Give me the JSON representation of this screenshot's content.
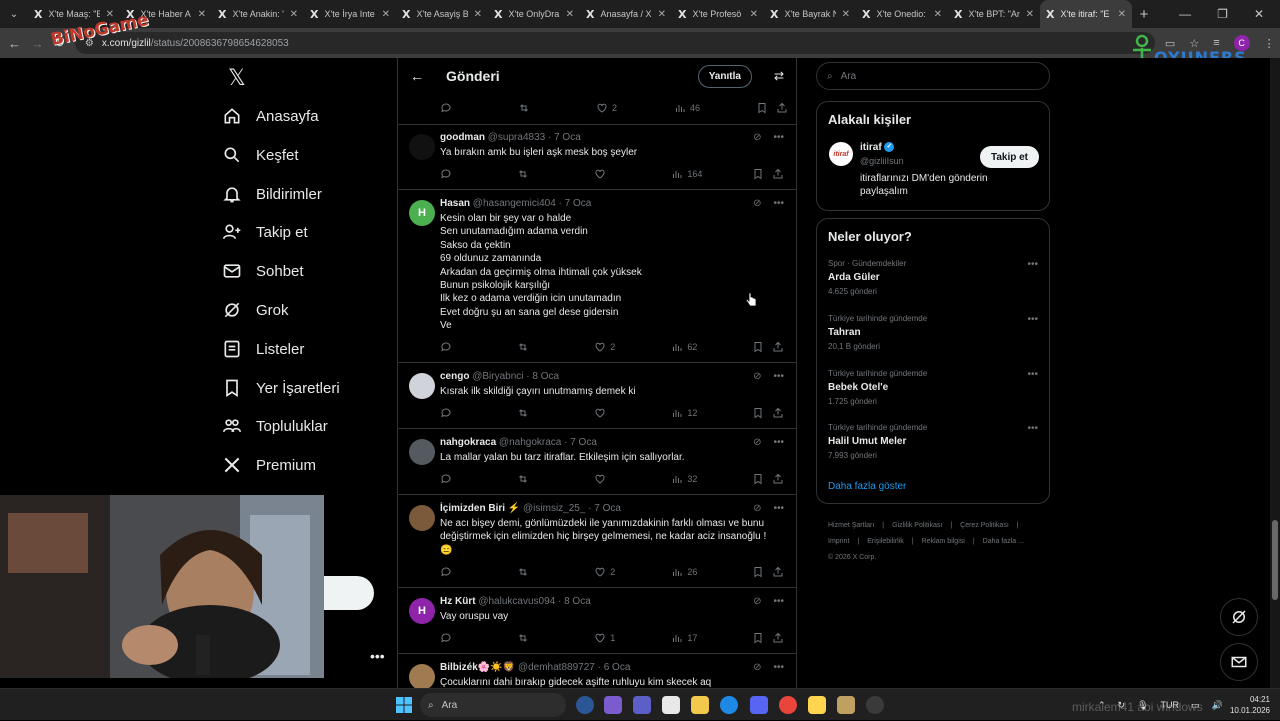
{
  "browser": {
    "tabs": [
      {
        "label": "X'te Maaş: \"B"
      },
      {
        "label": "X'te Haber A"
      },
      {
        "label": "X'te Anakin: \""
      },
      {
        "label": "X'te İrya Inte"
      },
      {
        "label": "X'te Asayiş B"
      },
      {
        "label": "X'te OnlyDra"
      },
      {
        "label": "Anasayfa / X"
      },
      {
        "label": "X'te Profesö"
      },
      {
        "label": "X'te Bayrak N"
      },
      {
        "label": "X'te Onedio:"
      },
      {
        "label": "X'te BPT: \"Ar"
      },
      {
        "label": "X'te itiraf: \"E"
      }
    ],
    "url_prefix": "x.com/gizlil",
    "url_rest": "/status/2008636798654628053"
  },
  "overlay": {
    "left_logo": "BiNoGame",
    "right_logo": "OYUNERS"
  },
  "nav": {
    "items": [
      {
        "label": "Anasayfa"
      },
      {
        "label": "Keşfet"
      },
      {
        "label": "Bildirimler"
      },
      {
        "label": "Takip et"
      },
      {
        "label": "Sohbet"
      },
      {
        "label": "Grok"
      },
      {
        "label": "Listeler"
      },
      {
        "label": "Yer İşaretleri"
      },
      {
        "label": "Topluluklar"
      },
      {
        "label": "Premium"
      }
    ],
    "post_button_visible": "nla"
  },
  "header": {
    "title": "Gönderi",
    "reply_button": "Yanıtla"
  },
  "top_actions": {
    "likes": "2",
    "views": "46"
  },
  "posts": [
    {
      "name": "goodman",
      "handle": "@supra4833 · 7 Oca",
      "text": [
        "Ya bırakın amk bu işleri aşk mesk boş şeyler"
      ],
      "replies": "",
      "reposts": "",
      "likes": "",
      "views": "164",
      "avatar_letter": "",
      "avatar_color": "#111111"
    },
    {
      "name": "Hasan",
      "handle": "@hasangemici404 · 7 Oca",
      "text": [
        "Kesin olan bir şey var o halde",
        "Sen unutamadığım adama verdin",
        "Sakso da çektin",
        "69 oldunuz zamanında",
        "Arkadan da  geçirmiş olma ihtimali çok yüksek",
        "Bunun psikolojik karşılığı",
        "Ilk kez  o adama verdiğin icin unutamadın",
        "Evet doğru şu an sana gel dese gidersin",
        "Ve"
      ],
      "likes": "2",
      "views": "62",
      "avatar_letter": "H",
      "avatar_color": "#4caf50"
    },
    {
      "name": "cengo",
      "handle": "@Biryabnci · 8 Oca",
      "text": [
        "Kısrak ilk skildiği çayırı unutmamış demek ki"
      ],
      "likes": "",
      "views": "12",
      "avatar_letter": "",
      "avatar_color": "#d0d4da"
    },
    {
      "name": "nahgokraca",
      "handle": "@nahgokraca · 7 Oca",
      "text": [
        "La mallar yalan bu tarz itiraflar. Etkileşim için sallıyorlar."
      ],
      "likes": "",
      "views": "32",
      "avatar_letter": "",
      "avatar_color": "#555a60"
    },
    {
      "name": "İçimizden Biri ⚡",
      "handle": "@isimsiz_25_ · 7 Oca",
      "text": [
        "Ne acı bişey demi, gönlümüzdeki ile yanımızdakinin farklı olması ve bunu",
        "değiştirmek için elimizden hiç birşey gelmemesi, ne kadar aciz insanoğlu !",
        "😑"
      ],
      "likes": "2",
      "views": "26",
      "avatar_letter": "",
      "avatar_color": "#7a5a3a"
    },
    {
      "name": "Hz Kürt",
      "handle": "@halukcavus094 · 8 Oca",
      "text": [
        "Vay oruspu vay"
      ],
      "likes": "1",
      "views": "17",
      "avatar_letter": "H",
      "avatar_color": "#8e24aa"
    },
    {
      "name": "Bilbizék🌸☀️🦁",
      "handle": "@demhat889727 · 6 Oca",
      "text": [
        "Çocuklarını dahi bırakıp gidecek aşifte ruhluyu kim skecek aq"
      ],
      "likes": "",
      "views": "",
      "avatar_letter": "",
      "avatar_color": "#a07a50"
    }
  ],
  "right": {
    "search_placeholder": "Ara",
    "related_title": "Alakalı kişiler",
    "related": {
      "name": "itiraf",
      "handle": "@gizliiIsun",
      "bio": "itiraflarınızı DM'den gönderin paylaşalım",
      "follow": "Takip et",
      "avatar_text": "itiraf"
    },
    "trends_title": "Neler oluyor?",
    "trends": [
      {
        "context": "Spor · Gündemdekiler",
        "title": "Arda Güler",
        "count": "4.625 gönderi"
      },
      {
        "context": "Türkiye tarihinde gündemde",
        "title": "Tahran",
        "count": "20,1 B gönderi"
      },
      {
        "context": "Türkiye tarihinde gündemde",
        "title": "Bebek Otel'e",
        "count": "1.725 gönderi"
      },
      {
        "context": "Türkiye tarihinde gündemde",
        "title": "Halil Umut Meler",
        "count": "7.993 gönderi"
      }
    ],
    "show_more": "Daha fazla göster",
    "footer": [
      "Hizmet Şartları",
      "|",
      "Gizlilik Politikası",
      "|",
      "Çerez Politikası",
      "|",
      "Imprint",
      "|",
      "Erişilebilirlik",
      "|",
      "Reklam bilgisi",
      "|",
      "Daha fazla ...",
      "© 2026 X Corp."
    ]
  },
  "taskbar": {
    "search": "Ara",
    "lang": "TUR",
    "time": "04:21",
    "date": "10.01.2026"
  },
  "watermark": "mirkalem41 abi windows"
}
